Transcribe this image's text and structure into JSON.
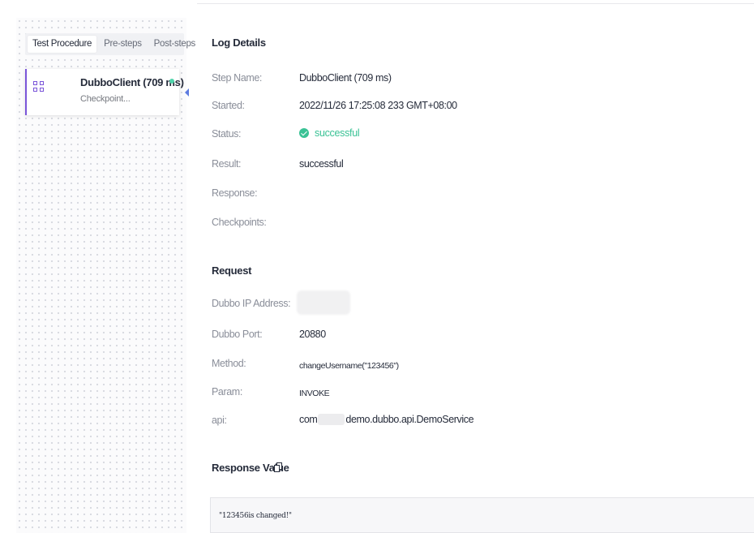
{
  "left_panel": {
    "tabs": [
      {
        "label": "Test Procedure",
        "active": true
      },
      {
        "label": "Pre-steps",
        "active": false
      },
      {
        "label": "Post-steps",
        "active": false
      }
    ],
    "step": {
      "title": "DubboClient (709 ms)",
      "subtitle": "Checkpoint...",
      "icon": "grid-icon",
      "status_color": "#50d4ab"
    }
  },
  "log_details": {
    "title": "Log Details",
    "step_name_label": "Step Name:",
    "step_name_value": "DubboClient (709 ms)",
    "started_label": "Started:",
    "started_value": "2022/11/26 17:25:08 233 GMT+08:00",
    "status_label": "Status:",
    "status_value": "successful",
    "status_icon": "check-circle-icon",
    "status_color": "#3ac295",
    "result_label": "Result:",
    "result_value": "successful",
    "response_label": "Response:",
    "checkpoints_label": "Checkpoints:"
  },
  "request": {
    "title": "Request",
    "ip_label": "Dubbo IP Address:",
    "port_label": "Dubbo Port:",
    "port_value": "20880",
    "method_label": "Method:",
    "method_value": "changeUsername(\"123456\")",
    "param_label": "Param:",
    "param_value": "INVOKE",
    "api_label": "api:",
    "api_prefix": "com",
    "api_suffix": "demo.dubbo.api.DemoService"
  },
  "response_value": {
    "title": "Response Value",
    "icon": "copy-icon",
    "code": "\"123456is changed!\""
  },
  "colors": {
    "accent": "#5e7ce0",
    "step_border": "#7a55d9",
    "success": "#3ac295"
  }
}
